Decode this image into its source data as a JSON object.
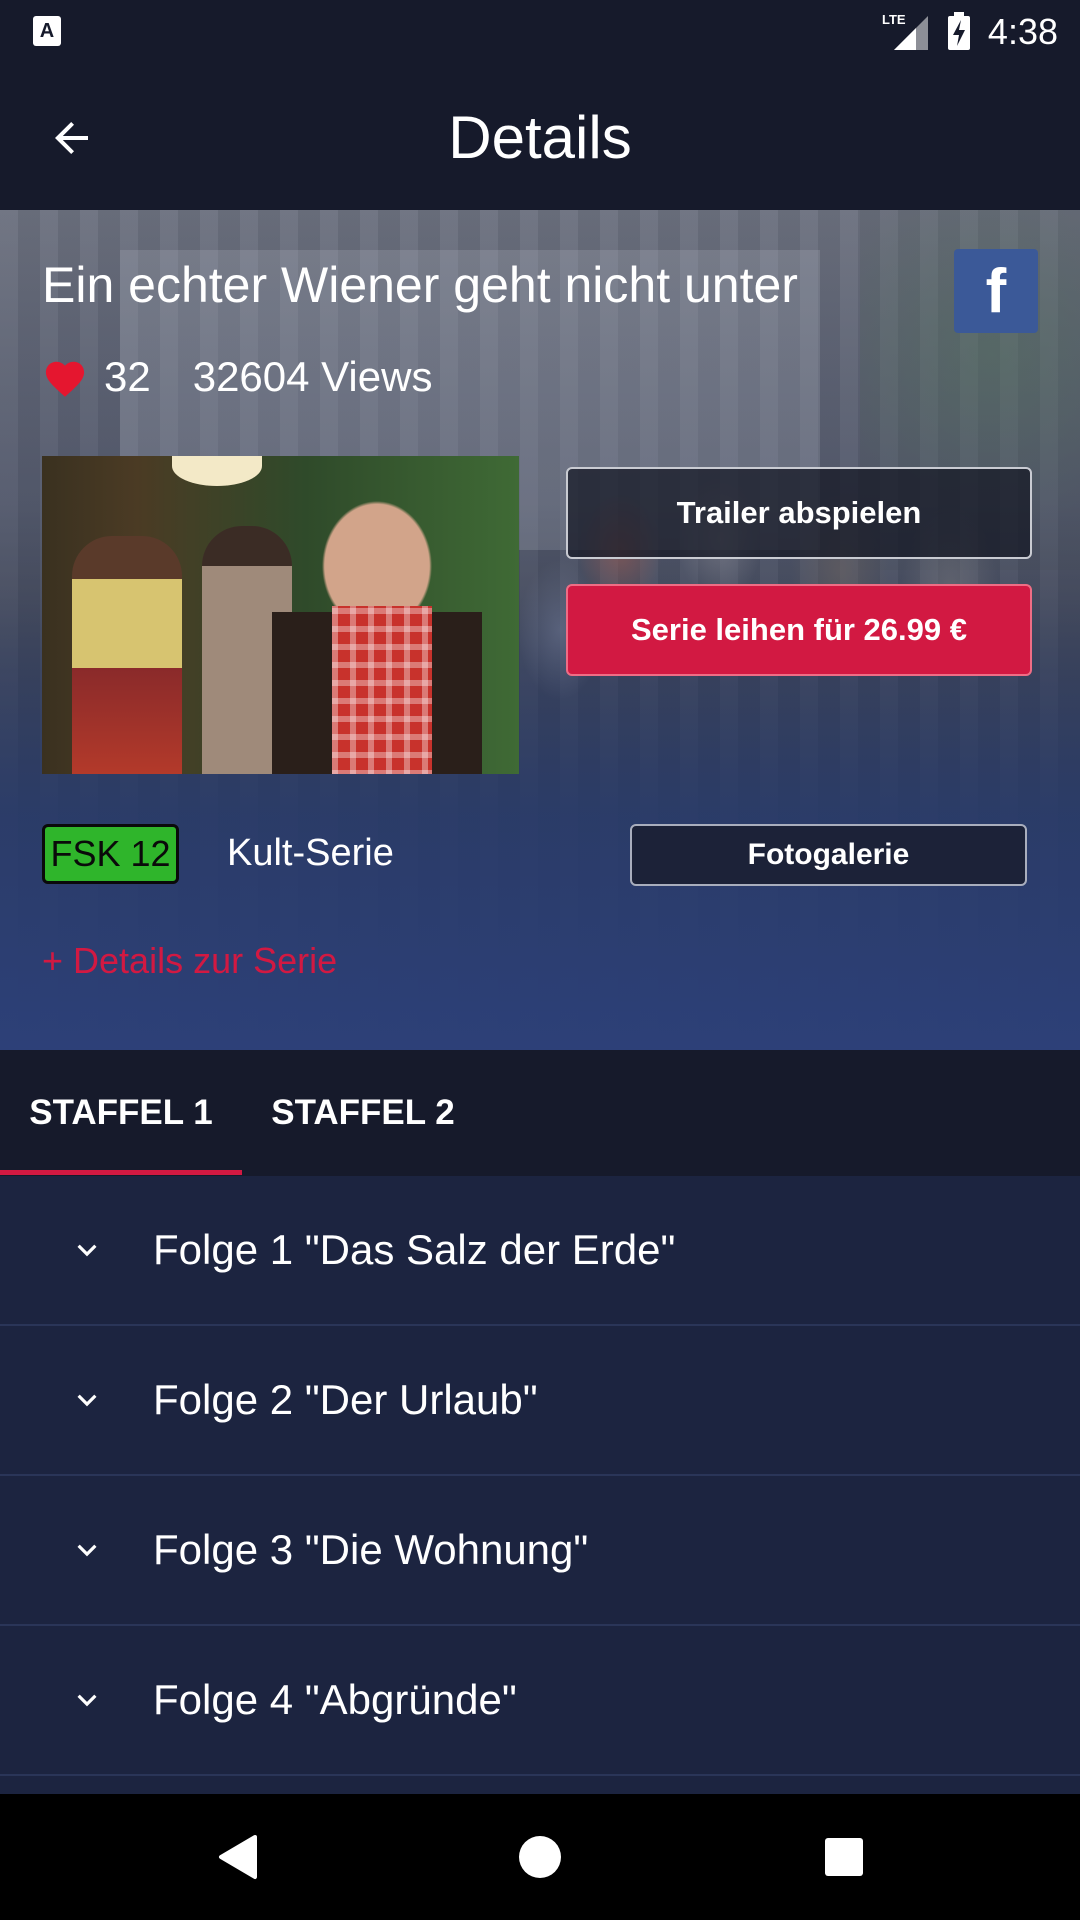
{
  "status_bar": {
    "time": "4:38",
    "network": "LTE",
    "left_icon": "A"
  },
  "app_bar": {
    "title": "Details",
    "back_icon": "arrow-back-icon"
  },
  "series": {
    "title": "Ein echter Wiener geht nicht unter",
    "likes": "32",
    "views": "32604 Views",
    "fsk": "FSK 12",
    "genre": "Kult-Serie",
    "details_link": "+ Details zur Serie"
  },
  "actions": {
    "trailer": "Trailer abspielen",
    "rent": "Serie leihen für 26.99 €",
    "gallery": "Fotogalerie",
    "facebook": "f"
  },
  "tabs": [
    {
      "label": "STAFFEL 1",
      "active": true
    },
    {
      "label": "STAFFEL 2",
      "active": false
    }
  ],
  "episodes": [
    {
      "title": "Folge 1 \"Das Salz der Erde\""
    },
    {
      "title": "Folge 2 \"Der Urlaub\""
    },
    {
      "title": "Folge 3 \"Die Wohnung\""
    },
    {
      "title": "Folge 4 \"Abgründe\""
    },
    {
      "title": ""
    }
  ],
  "colors": {
    "accent": "#d21942",
    "background": "#161a2b",
    "list_background": "#1c2440",
    "fsk_green": "#2fb52b",
    "facebook_blue": "#3b5998"
  }
}
